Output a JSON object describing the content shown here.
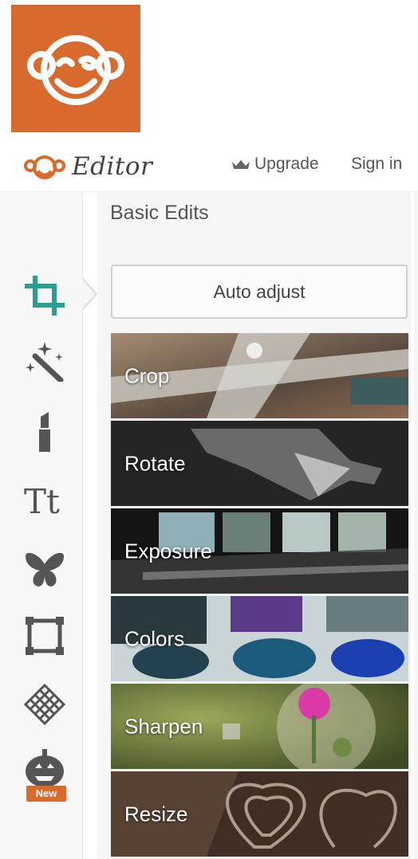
{
  "app": {
    "brand_word": "Editor",
    "accent_color": "#d86a2e",
    "teal_color": "#2a9e8f"
  },
  "header": {
    "upgrade_label": "Upgrade",
    "signin_label": "Sign in"
  },
  "rail": {
    "items": [
      {
        "icon": "crop-icon",
        "active": true
      },
      {
        "icon": "magic-wand-icon"
      },
      {
        "icon": "lipstick-icon"
      },
      {
        "icon": "text-icon"
      },
      {
        "icon": "butterfly-icon"
      },
      {
        "icon": "frame-icon"
      },
      {
        "icon": "texture-icon"
      },
      {
        "icon": "pumpkin-icon",
        "badge": "New"
      }
    ]
  },
  "panel": {
    "title": "Basic Edits",
    "auto_adjust_label": "Auto adjust",
    "tools": [
      {
        "label": "Crop"
      },
      {
        "label": "Rotate"
      },
      {
        "label": "Exposure"
      },
      {
        "label": "Colors"
      },
      {
        "label": "Sharpen"
      },
      {
        "label": "Resize"
      }
    ]
  }
}
